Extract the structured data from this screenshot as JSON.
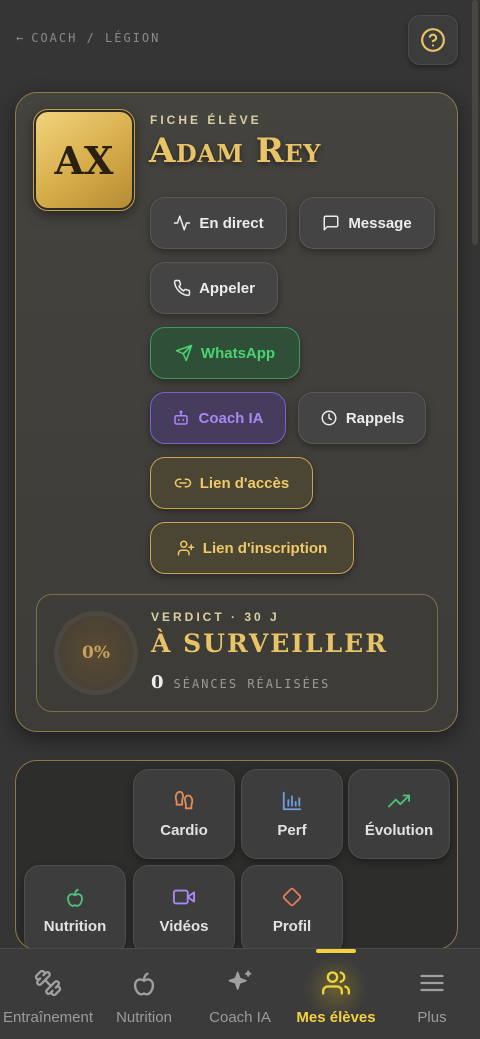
{
  "breadcrumb": {
    "back_arrow": "←",
    "text": "COACH / LÉGION"
  },
  "header": {
    "help_icon": "help-circle-icon"
  },
  "student": {
    "eyebrow": "FICHE ÉLÈVE",
    "initials": "AX",
    "name": "Adam Rey"
  },
  "actions": {
    "live": "En direct",
    "message": "Message",
    "call": "Appeler",
    "whatsapp": "WhatsApp",
    "coach_ai": "Coach IA",
    "reminders": "Rappels",
    "access_link": "Lien d'accès",
    "signup_link": "Lien d'inscription"
  },
  "verdict": {
    "label": "VERDICT · 30 J",
    "status": "À SURVEILLER",
    "percent": "0%",
    "sessions_count": "0",
    "sessions_label": "SÉANCES RÉALISÉES"
  },
  "tools": [
    {
      "label": "Cardio",
      "icon": "footprints-icon"
    },
    {
      "label": "Perf",
      "icon": "bar-chart-icon"
    },
    {
      "label": "Évolution",
      "icon": "trending-up-icon"
    },
    {
      "label": "Nutrition",
      "icon": "apple-icon"
    },
    {
      "label": "Vidéos",
      "icon": "video-icon"
    },
    {
      "label": "Profil",
      "icon": "diamond-icon"
    }
  ],
  "nav": [
    {
      "label": "Entraînement",
      "icon": "dumbbell-icon"
    },
    {
      "label": "Nutrition",
      "icon": "apple-icon"
    },
    {
      "label": "Coach IA",
      "icon": "sparkles-icon"
    },
    {
      "label": "Mes élèves",
      "icon": "users-icon",
      "active": true
    },
    {
      "label": "Plus",
      "icon": "menu-icon"
    }
  ],
  "colors": {
    "gold": "#e9c467",
    "nav_active": "#f4d23c",
    "whatsapp_green": "#4ad36f",
    "coach_purple": "#a987f5",
    "background": "#353535"
  }
}
